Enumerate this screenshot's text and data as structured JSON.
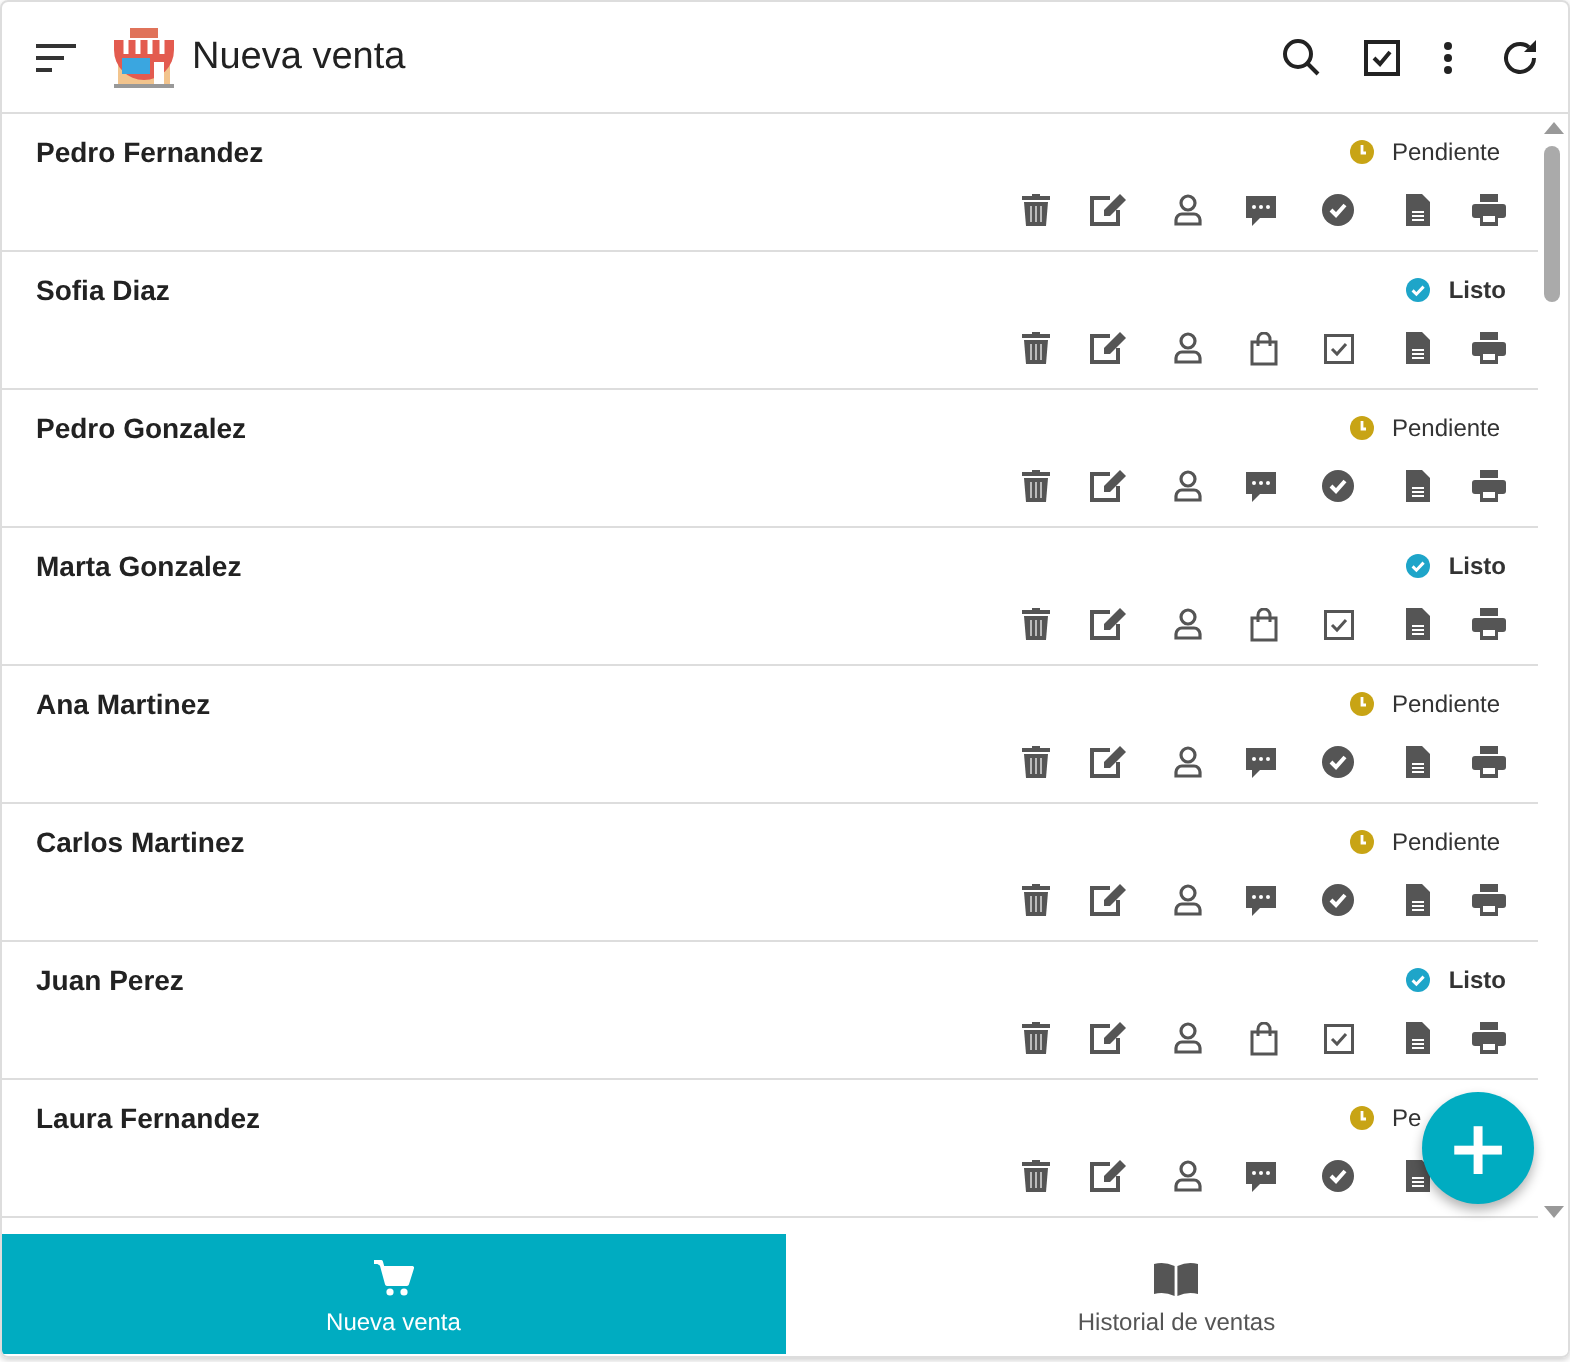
{
  "header": {
    "title": "Nueva venta"
  },
  "sales": [
    {
      "customer": "Pedro Fernandez",
      "status": {
        "kind": "pending",
        "label": "Pendiente"
      }
    },
    {
      "customer": "Sofia Diaz",
      "status": {
        "kind": "done",
        "label": "Listo"
      }
    },
    {
      "customer": "Pedro Gonzalez",
      "status": {
        "kind": "pending",
        "label": "Pendiente"
      }
    },
    {
      "customer": "Marta Gonzalez",
      "status": {
        "kind": "done",
        "label": "Listo"
      }
    },
    {
      "customer": "Ana Martinez",
      "status": {
        "kind": "pending",
        "label": "Pendiente"
      }
    },
    {
      "customer": "Carlos Martinez",
      "status": {
        "kind": "pending",
        "label": "Pendiente"
      }
    },
    {
      "customer": "Juan Perez",
      "status": {
        "kind": "done",
        "label": "Listo"
      }
    },
    {
      "customer": "Laura Fernandez",
      "status": {
        "kind": "pending",
        "label": "Pe"
      }
    }
  ],
  "fab": {
    "label": "+"
  },
  "bottom_nav": [
    {
      "kind": "cart",
      "label": "Nueva venta",
      "selected": true
    },
    {
      "kind": "book",
      "label": "Historial de ventas",
      "selected": false
    }
  ]
}
